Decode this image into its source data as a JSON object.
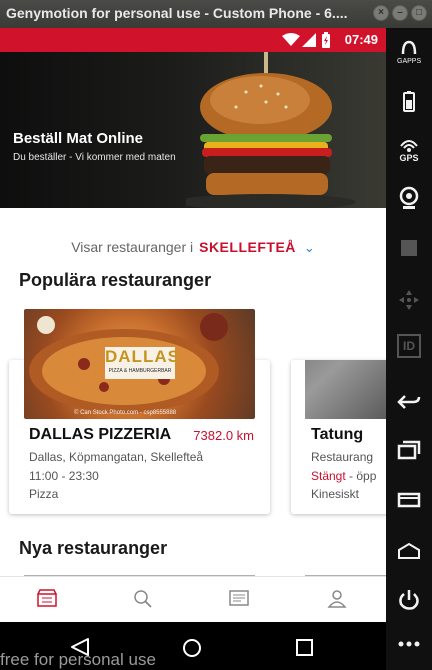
{
  "window": {
    "title": "Genymotion for personal use - Custom Phone - 6...."
  },
  "statusbar": {
    "time": "07:49"
  },
  "hero": {
    "title": "Beställ Mat Online",
    "subtitle": "Du beställer - Vi kommer med maten"
  },
  "city_selector": {
    "prefix": "Visar restauranger i",
    "city": "SKELLEFTEÅ"
  },
  "sections": {
    "popular": "Populära restauranger",
    "new": "Nya restauranger"
  },
  "popular_restaurants": [
    {
      "name": "DALLAS PIZZERIA",
      "distance": "7382.0 km",
      "address": "Dallas, Köpmangatan, Skellefteå",
      "hours": "11:00 - 23:30",
      "category": "Pizza",
      "logo_text": "DALLAS",
      "logo_subtext": "PIZZA & HAMBURGERBAR",
      "photo_credit": "© Can Stock Photo.com - csp8555888"
    },
    {
      "name": "Tatung",
      "address": "Restaurang",
      "status": "Stängt",
      "status_suffix": " - öpp",
      "category": "Kinesiskt"
    }
  ],
  "sidepanel": {
    "gapps_label": "GAPPS",
    "gps_label": "GPS",
    "id_label": "ID"
  },
  "watermark": "free for personal use",
  "colors": {
    "brand_red": "#d0122a",
    "accent_blue": "#3a7bd5"
  }
}
